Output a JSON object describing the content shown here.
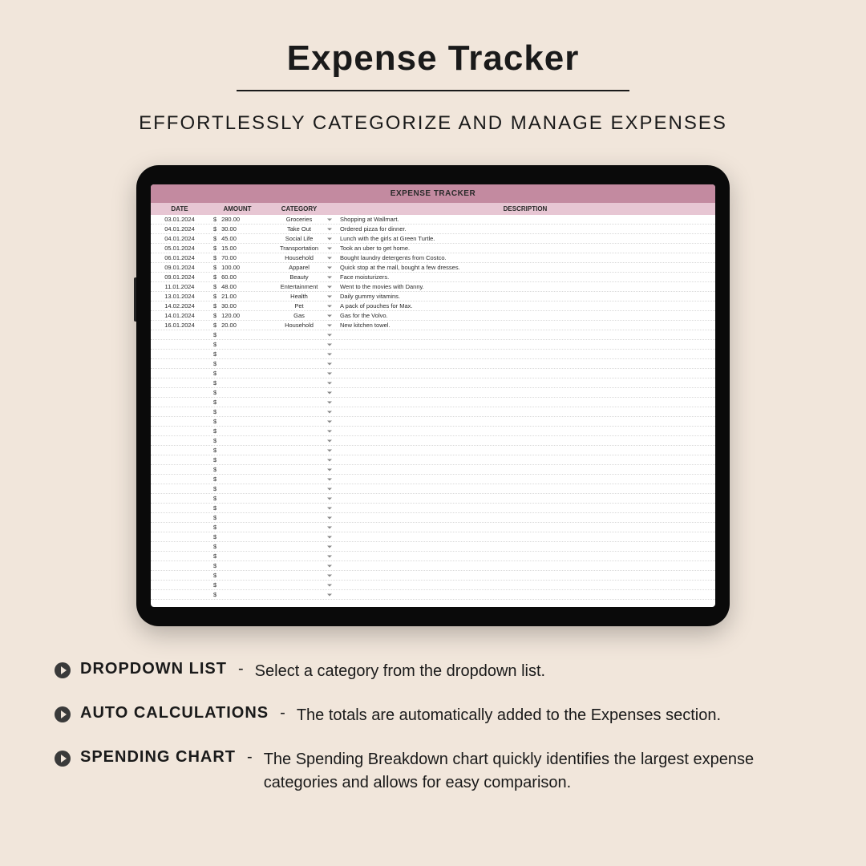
{
  "header": {
    "title": "Expense Tracker",
    "subtitle": "EFFORTLESSLY CATEGORIZE AND MANAGE EXPENSES"
  },
  "sheet": {
    "title": "EXPENSE TRACKER",
    "columns": {
      "date": "DATE",
      "amount": "AMOUNT",
      "category": "CATEGORY",
      "description": "DESCRIPTION"
    },
    "currency": "$",
    "rows": [
      {
        "date": "03.01.2024",
        "amount": "280.00",
        "category": "Groceries",
        "description": "Shopping at Wallmart."
      },
      {
        "date": "04.01.2024",
        "amount": "30.00",
        "category": "Take Out",
        "description": "Ordered pizza for dinner."
      },
      {
        "date": "04.01.2024",
        "amount": "45.00",
        "category": "Social Life",
        "description": "Lunch with the girls at Green Turtle."
      },
      {
        "date": "05.01.2024",
        "amount": "15.00",
        "category": "Transportation",
        "description": "Took an uber to get home."
      },
      {
        "date": "06.01.2024",
        "amount": "70.00",
        "category": "Household",
        "description": "Bought laundry detergents from Costco."
      },
      {
        "date": "09.01.2024",
        "amount": "100.00",
        "category": "Apparel",
        "description": "Quick stop at the mall, bought a few dresses."
      },
      {
        "date": "09.01.2024",
        "amount": "60.00",
        "category": "Beauty",
        "description": "Face moisturizers."
      },
      {
        "date": "11.01.2024",
        "amount": "48.00",
        "category": "Entertainment",
        "description": "Went to the movies with Danny."
      },
      {
        "date": "13.01.2024",
        "amount": "21.00",
        "category": "Health",
        "description": "Daily gummy vitamins."
      },
      {
        "date": "14.02.2024",
        "amount": "30.00",
        "category": "Pet",
        "description": "A pack of pouches for Max."
      },
      {
        "date": "14.01.2024",
        "amount": "120.00",
        "category": "Gas",
        "description": "Gas for the Volvo."
      },
      {
        "date": "16.01.2024",
        "amount": "20.00",
        "category": "Household",
        "description": "New kitchen towel."
      }
    ],
    "empty_row_count": 28
  },
  "features": [
    {
      "label": "DROPDOWN LIST",
      "desc": "Select a category from the dropdown list."
    },
    {
      "label": "AUTO CALCULATIONS",
      "desc": "The totals are automatically added to the Expenses section."
    },
    {
      "label": "SPENDING CHART",
      "desc": "The Spending Breakdown chart quickly identifies the largest expense categories and allows for easy comparison."
    }
  ]
}
